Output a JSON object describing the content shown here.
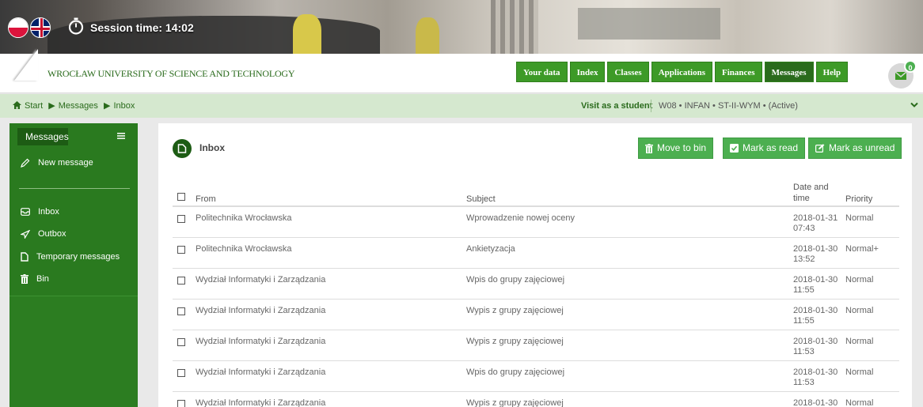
{
  "session": {
    "label": "Session time: 14:02"
  },
  "header": {
    "university": "WROCŁAW UNIVERSITY OF SCIENCE AND TECHNOLOGY",
    "nav": [
      "Your data",
      "Index",
      "Classes",
      "Applications",
      "Finances",
      "Messages",
      "Help"
    ],
    "active_nav": "Messages",
    "mail_count": "0"
  },
  "breadcrumb": {
    "items": [
      "Start",
      "Messages",
      "Inbox"
    ],
    "visit_label": "Visit as a student",
    "program": "W08 • INFAN • ST-II-WYM • (Active)"
  },
  "sidebar": {
    "title": "Messages",
    "new_message": "New message",
    "items": [
      {
        "label": "Inbox",
        "icon": "inbox-icon"
      },
      {
        "label": "Outbox",
        "icon": "send-icon"
      },
      {
        "label": "Temporary messages",
        "icon": "draft-icon"
      },
      {
        "label": "Bin",
        "icon": "trash-icon"
      }
    ]
  },
  "main": {
    "title": "Inbox",
    "actions": {
      "move_to_bin": "Move to bin",
      "mark_read": "Mark as read",
      "mark_unread": "Mark as unread"
    },
    "columns": {
      "from": "From",
      "subject": "Subject",
      "date_line1": "Date and",
      "date_line2": "time",
      "priority": "Priority"
    },
    "rows": [
      {
        "from": "Politechnika Wrocławska",
        "subject": "Wprowadzenie nowej oceny",
        "date": "2018-01-31",
        "time": "07:43",
        "priority": "Normal"
      },
      {
        "from": "Politechnika Wrocławska",
        "subject": "Ankietyzacja",
        "date": "2018-01-30",
        "time": "13:52",
        "priority": "Normal+"
      },
      {
        "from": "Wydział Informatyki i Zarządzania",
        "subject": "Wpis do grupy zajęciowej",
        "date": "2018-01-30",
        "time": "11:55",
        "priority": "Normal"
      },
      {
        "from": "Wydział Informatyki i Zarządzania",
        "subject": "Wypis z grupy zajęciowej",
        "date": "2018-01-30",
        "time": "11:55",
        "priority": "Normal"
      },
      {
        "from": "Wydział Informatyki i Zarządzania",
        "subject": "Wypis z grupy zajęciowej",
        "date": "2018-01-30",
        "time": "11:53",
        "priority": "Normal"
      },
      {
        "from": "Wydział Informatyki i Zarządzania",
        "subject": "Wpis do grupy zajęciowej",
        "date": "2018-01-30",
        "time": "11:53",
        "priority": "Normal"
      },
      {
        "from": "Wydział Informatyki i Zarządzania",
        "subject": "Wypis z grupy zajęciowej",
        "date": "2018-01-30",
        "time": "",
        "priority": "Normal"
      }
    ]
  },
  "colors": {
    "brand_green": "#3d9a27",
    "dark_green": "#2a6b1c",
    "action_green": "#4caf50",
    "sidebar_green": "#2a7a1f"
  }
}
